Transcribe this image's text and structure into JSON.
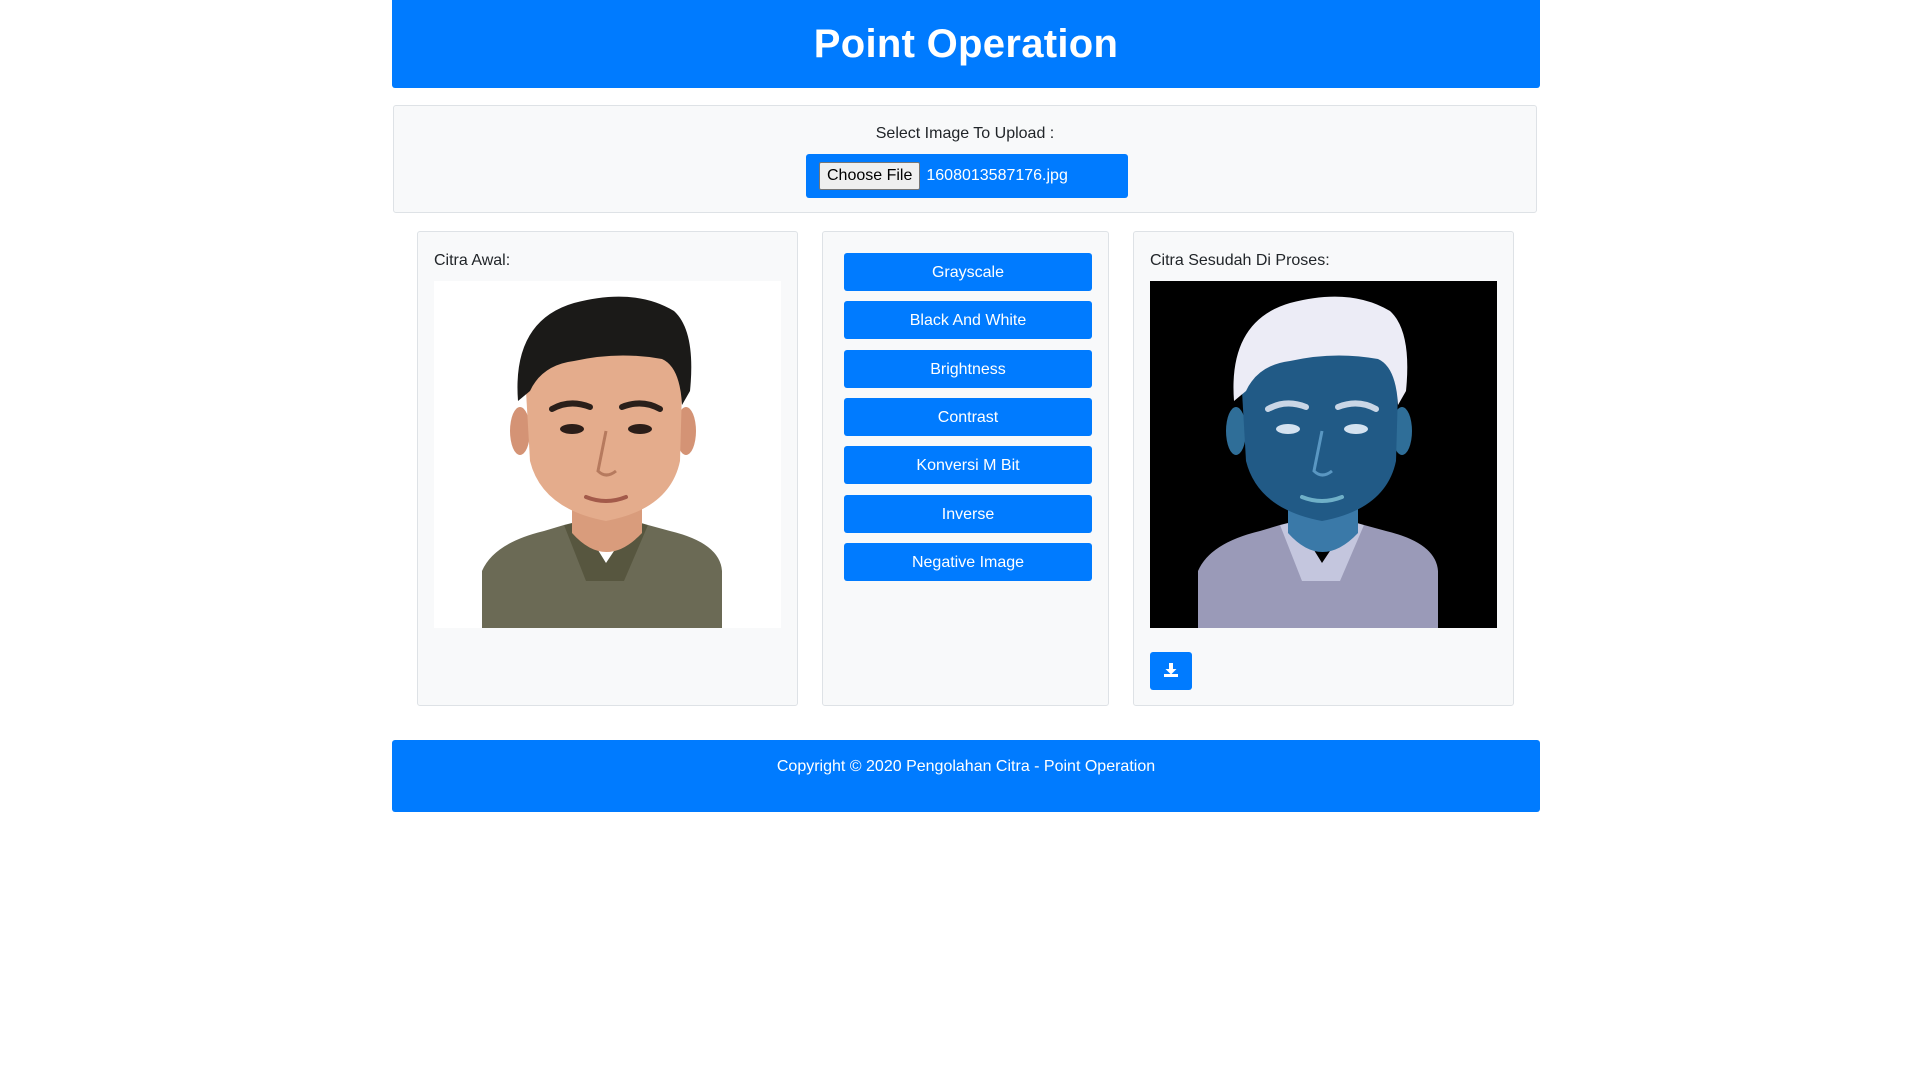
{
  "header": {
    "title": "Point Operation"
  },
  "upload": {
    "label": "Select Image To Upload :",
    "choose_button": "Choose File",
    "file_name": "1608013587176.jpg"
  },
  "original_panel": {
    "title": "Citra Awal:"
  },
  "operations": {
    "buttons": [
      "Grayscale",
      "Black And White",
      "Brightness",
      "Contrast",
      "Konversi M Bit",
      "Inverse",
      "Negative Image"
    ]
  },
  "processed_panel": {
    "title": "Citra Sesudah Di Proses:",
    "download_icon": "download-icon"
  },
  "footer": {
    "text": "Copyright © 2020 Pengolahan Citra - Point Operation"
  },
  "colors": {
    "primary": "#007bff",
    "panel_bg": "#f8f9fa",
    "border": "#dee2e6"
  }
}
